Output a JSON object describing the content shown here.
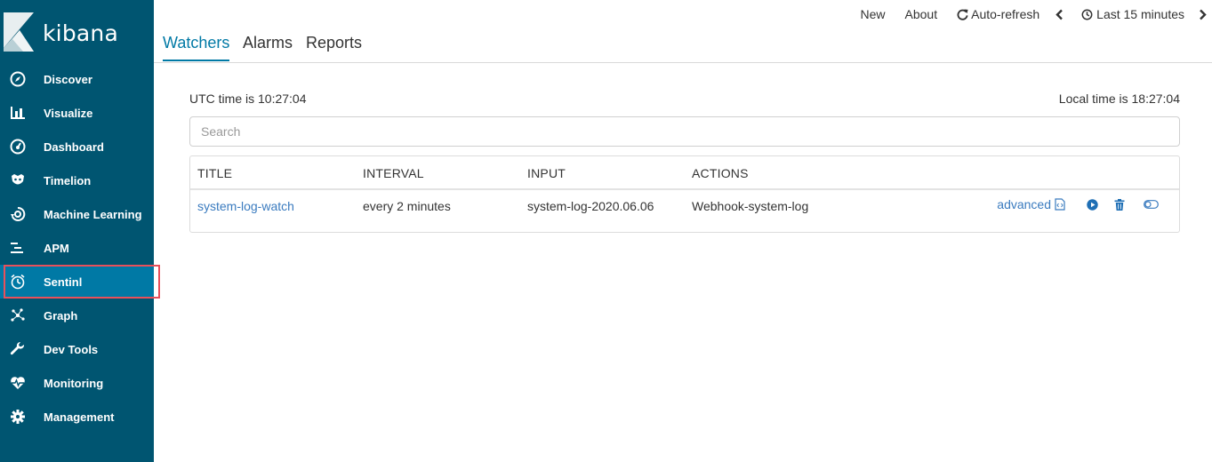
{
  "app": {
    "name": "kibana"
  },
  "sidebar": {
    "items": [
      {
        "label": "Discover",
        "icon": "compass-icon"
      },
      {
        "label": "Visualize",
        "icon": "bar-chart-icon"
      },
      {
        "label": "Dashboard",
        "icon": "gauge-icon"
      },
      {
        "label": "Timelion",
        "icon": "timelion-icon"
      },
      {
        "label": "Machine Learning",
        "icon": "machine-learning-icon"
      },
      {
        "label": "APM",
        "icon": "apm-icon"
      },
      {
        "label": "Sentinl",
        "icon": "alarm-clock-icon",
        "active": true
      },
      {
        "label": "Graph",
        "icon": "graph-icon"
      },
      {
        "label": "Dev Tools",
        "icon": "wrench-icon"
      },
      {
        "label": "Monitoring",
        "icon": "heartbeat-icon"
      },
      {
        "label": "Management",
        "icon": "gear-icon"
      }
    ]
  },
  "topbar": {
    "new_label": "New",
    "about_label": "About",
    "autorefresh_label": "Auto-refresh",
    "time_range_label": "Last 15 minutes"
  },
  "tabs": [
    {
      "label": "Watchers",
      "active": true
    },
    {
      "label": "Alarms"
    },
    {
      "label": "Reports"
    }
  ],
  "main": {
    "utc_time": "UTC time is 10:27:04",
    "local_time": "Local time is 18:27:04",
    "search_placeholder": "Search"
  },
  "table": {
    "columns": [
      "TITLE",
      "INTERVAL",
      "INPUT",
      "ACTIONS"
    ],
    "rows": [
      {
        "title": "system-log-watch",
        "interval": "every 2 minutes",
        "input": "system-log-2020.06.06",
        "actions": "Webhook-system-log",
        "advanced_label": "advanced"
      }
    ]
  },
  "colors": {
    "sidebar_bg": "#005571",
    "sidebar_active": "#0079a5",
    "accent": "#0079a5",
    "link": "#3a7bbf",
    "highlight_outline": "#e8505b"
  }
}
